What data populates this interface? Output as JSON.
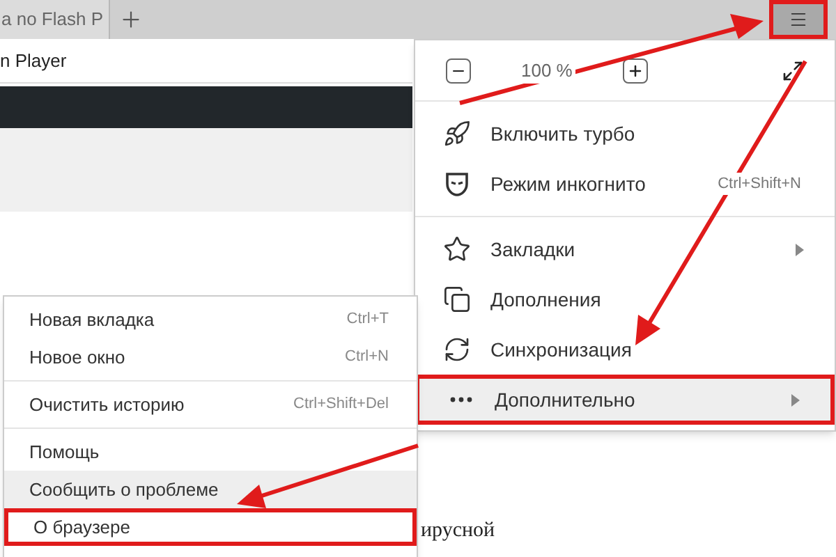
{
  "tab": {
    "title": "a no Flash P"
  },
  "address_text": "n Player",
  "menu_button": {
    "outlined": true
  },
  "main_menu": {
    "zoom": {
      "value": "100 %"
    },
    "sections": [
      [
        {
          "kind": "turbo",
          "label": "Включить турбо",
          "highlighted": false,
          "outlined": false
        },
        {
          "kind": "incognito",
          "label": "Режим инкогнито",
          "shortcut": "Ctrl+Shift+N",
          "highlighted": false,
          "outlined": false
        }
      ],
      [
        {
          "kind": "bookmarks",
          "label": "Закладки",
          "submenu": true,
          "highlighted": false,
          "outlined": false
        },
        {
          "kind": "addons",
          "label": "Дополнения",
          "highlighted": false,
          "outlined": false
        },
        {
          "kind": "sync",
          "label": "Синхронизация",
          "highlighted": false,
          "outlined": false
        },
        {
          "kind": "more",
          "label": "Дополнительно",
          "submenu": true,
          "highlighted": true,
          "outlined": true
        }
      ]
    ]
  },
  "submenu": {
    "sections": [
      [
        {
          "label": "Новая вкладка",
          "shortcut": "Ctrl+T",
          "highlighted": false,
          "outlined": false
        },
        {
          "label": "Новое окно",
          "shortcut": "Ctrl+N",
          "highlighted": false,
          "outlined": false
        }
      ],
      [
        {
          "label": "Очистить историю",
          "shortcut": "Ctrl+Shift+Del",
          "highlighted": false,
          "outlined": false
        }
      ],
      [
        {
          "label": "Помощь",
          "highlighted": false,
          "outlined": false
        },
        {
          "label": "Сообщить о проблеме",
          "highlighted": true,
          "outlined": false
        },
        {
          "label": "О браузере",
          "highlighted": false,
          "outlined": true
        }
      ]
    ]
  },
  "page_text": "ирусной"
}
